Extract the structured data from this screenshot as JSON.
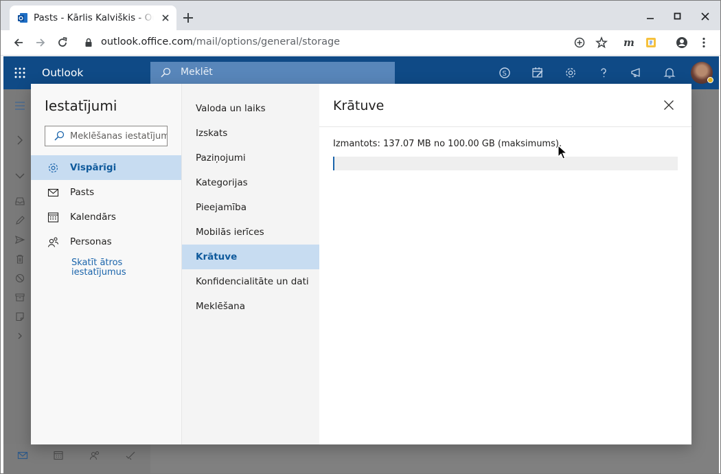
{
  "browser": {
    "tab_title": "Pasts - Kārlis Kalviškis - Outlook",
    "url_domain": "outlook.office.com",
    "url_path": "/mail/options/general/storage"
  },
  "outlook": {
    "brand": "Outlook",
    "search_placeholder": "Meklēt",
    "header_color": "#0f4a86"
  },
  "settings": {
    "title": "Iestatījumi",
    "search_placeholder": "Meklēšanas iestatījumi",
    "categories": [
      {
        "label": "Vispārīgi",
        "icon": "gear-icon",
        "active": true
      },
      {
        "label": "Pasts",
        "icon": "mail-icon",
        "active": false
      },
      {
        "label": "Kalendārs",
        "icon": "calendar-icon",
        "active": false
      },
      {
        "label": "Personas",
        "icon": "people-icon",
        "active": false
      }
    ],
    "quick_link": "Skatīt ātros iestatījumus",
    "subcategories": [
      {
        "label": "Valoda un laiks",
        "active": false
      },
      {
        "label": "Izskats",
        "active": false
      },
      {
        "label": "Paziņojumi",
        "active": false
      },
      {
        "label": "Kategorijas",
        "active": false
      },
      {
        "label": "Pieejamība",
        "active": false
      },
      {
        "label": "Mobilās ierīces",
        "active": false
      },
      {
        "label": "Krātuve",
        "active": true
      },
      {
        "label": "Konfidencialitāte un dati",
        "active": false
      },
      {
        "label": "Meklēšana",
        "active": false
      }
    ],
    "active_highlight_color": "#c7dcf1"
  },
  "storage": {
    "title": "Krātuve",
    "usage_text": "Izmantots: 137.07 MB no 100.00 GB (maksimums).",
    "usage_fraction": 0.0013
  }
}
